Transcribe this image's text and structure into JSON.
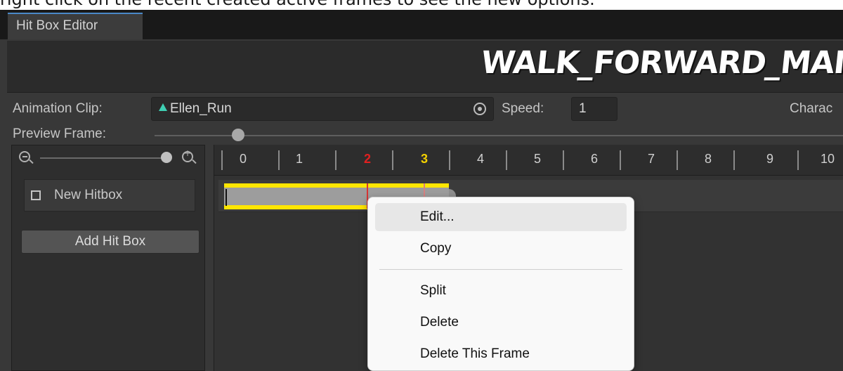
{
  "caption": "right click on the recent created active frames to see the new options.",
  "window": {
    "tab_label": "Hit Box Editor"
  },
  "header": {
    "clip_title": "WALK_FORWARD_MAI"
  },
  "clip_row": {
    "animation_clip_label": "Animation Clip:",
    "animation_clip_value": "Ellen_Run",
    "speed_label": "Speed:",
    "speed_value": "1",
    "character_label": "Charac"
  },
  "preview_row": {
    "preview_frame_label": "Preview Frame:"
  },
  "left_panel": {
    "hitbox_item_label": "New Hitbox",
    "add_button_label": "Add Hit Box"
  },
  "timeline": {
    "frames": [
      "0",
      "1",
      "2",
      "3",
      "4",
      "5",
      "6",
      "7",
      "8",
      "9",
      "10"
    ],
    "frame_colors": [
      "#cfcfcf",
      "#cfcfcf",
      "#e02020",
      "#f2d000",
      "#cfcfcf",
      "#cfcfcf",
      "#cfcfcf",
      "#cfcfcf",
      "#cfcfcf",
      "#cfcfcf",
      "#cfcfcf"
    ]
  },
  "context_menu": {
    "items": [
      "Edit...",
      "Copy",
      "Split",
      "Delete",
      "Delete This Frame"
    ]
  },
  "colors": {
    "active_frame_highlight": "#ffe600",
    "accent_tab": "#4a89c8"
  }
}
